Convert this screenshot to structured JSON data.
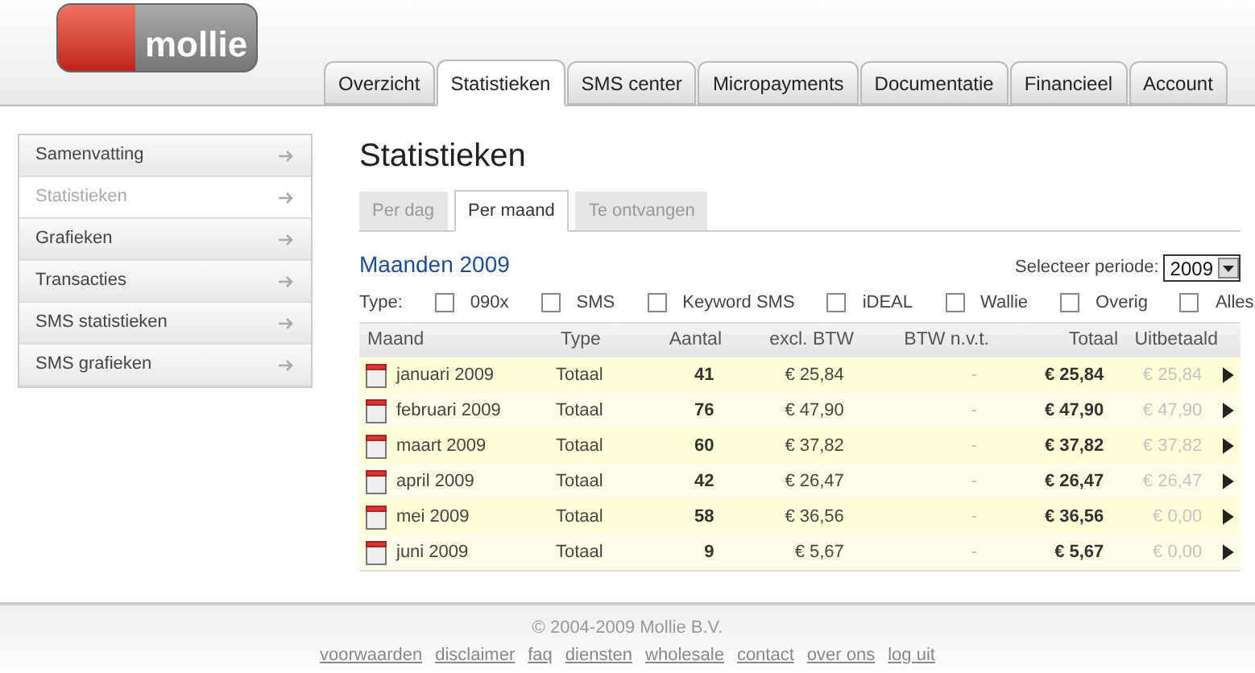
{
  "logo": {
    "text": "mollie"
  },
  "nav_tabs": [
    {
      "label": "Overzicht",
      "selected": false
    },
    {
      "label": "Statistieken",
      "selected": true
    },
    {
      "label": "SMS center",
      "selected": false
    },
    {
      "label": "Micropayments",
      "selected": false
    },
    {
      "label": "Documentatie",
      "selected": false
    },
    {
      "label": "Financieel",
      "selected": false
    },
    {
      "label": "Account",
      "selected": false
    }
  ],
  "sidebar": {
    "items": [
      {
        "label": "Samenvatting",
        "selected": false
      },
      {
        "label": "Statistieken",
        "selected": true
      },
      {
        "label": "Grafieken",
        "selected": false
      },
      {
        "label": "Transacties",
        "selected": false
      },
      {
        "label": "SMS statistieken",
        "selected": false
      },
      {
        "label": "SMS grafieken",
        "selected": false
      }
    ]
  },
  "page_title": "Statistieken",
  "sub_tabs": [
    {
      "label": "Per dag",
      "selected": false
    },
    {
      "label": "Per maand",
      "selected": true
    },
    {
      "label": "Te ontvangen",
      "selected": false
    }
  ],
  "section_title": "Maanden 2009",
  "period": {
    "label": "Selecteer periode:",
    "value": "2009"
  },
  "type_filter": {
    "label": "Type:",
    "options": [
      {
        "label": "090x",
        "checked": false
      },
      {
        "label": "SMS",
        "checked": false
      },
      {
        "label": "Keyword SMS",
        "checked": false
      },
      {
        "label": "iDEAL",
        "checked": false
      },
      {
        "label": "Wallie",
        "checked": false
      },
      {
        "label": "Overig",
        "checked": false
      },
      {
        "label": "Alles",
        "checked": false
      }
    ]
  },
  "table": {
    "columns": [
      "Maand",
      "Type",
      "Aantal",
      "excl. BTW",
      "BTW n.v.t.",
      "Totaal",
      "Uitbetaald"
    ],
    "rows": [
      {
        "month": "januari 2009",
        "type": "Totaal",
        "count": "41",
        "excl": "€ 25,84",
        "btw": "-",
        "total": "€ 25,84",
        "paid": "€ 25,84"
      },
      {
        "month": "februari 2009",
        "type": "Totaal",
        "count": "76",
        "excl": "€ 47,90",
        "btw": "-",
        "total": "€ 47,90",
        "paid": "€ 47,90"
      },
      {
        "month": "maart 2009",
        "type": "Totaal",
        "count": "60",
        "excl": "€ 37,82",
        "btw": "-",
        "total": "€ 37,82",
        "paid": "€ 37,82"
      },
      {
        "month": "april 2009",
        "type": "Totaal",
        "count": "42",
        "excl": "€ 26,47",
        "btw": "-",
        "total": "€ 26,47",
        "paid": "€ 26,47"
      },
      {
        "month": "mei 2009",
        "type": "Totaal",
        "count": "58",
        "excl": "€ 36,56",
        "btw": "-",
        "total": "€ 36,56",
        "paid": "€ 0,00"
      },
      {
        "month": "juni 2009",
        "type": "Totaal",
        "count": "9",
        "excl": "€ 5,67",
        "btw": "-",
        "total": "€ 5,67",
        "paid": "€ 0,00"
      }
    ]
  },
  "footer": {
    "copyright": "© 2004-2009 Mollie B.V.",
    "links": [
      "voorwaarden",
      "disclaimer",
      "faq",
      "diensten",
      "wholesale",
      "contact",
      "over ons",
      "log uit"
    ]
  }
}
